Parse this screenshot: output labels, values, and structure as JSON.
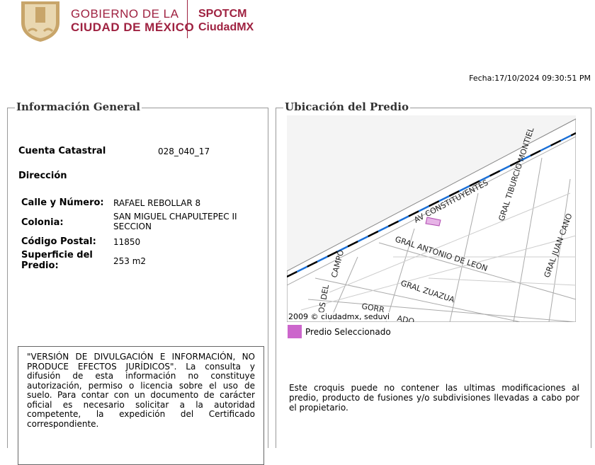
{
  "header": {
    "logo_text": "GOBIERNO DE LA CIUDAD DE MÉXICO",
    "gob_line1": "GOBIERNO DE LA",
    "gob_line2": "CIUDAD DE MÉXICO",
    "brand_line1": "SPOTCM",
    "brand_line2": "CiudadMX",
    "fecha": "Fecha:17/10/2024 09:30:51 PM"
  },
  "general": {
    "title": "Información General",
    "cuenta_label": "Cuenta Catastral",
    "cuenta_value": "028_040_17",
    "direccion_label": "Dirección",
    "calle_label": "Calle y Número:",
    "calle_value": "RAFAEL REBOLLAR 8",
    "colonia_label": "Colonia:",
    "colonia_value": "SAN MIGUEL CHAPULTEPEC II SECCION",
    "cp_label": "Código Postal:",
    "cp_value": "11850",
    "sup_label": "Superficie del Predio:",
    "sup_value": "253 m2",
    "disclaimer": "\"VERSIÓN DE DIVULGACIÓN E INFORMACIÓN, NO PRODUCE EFECTOS JURÍDICOS\". La consulta y difusión de esta información no constituye autorización, permiso o licencia sobre el uso de suelo. Para contar con un documento de carácter oficial es necesario solicitar a la autoridad competente, la expedición del Certificado correspondiente."
  },
  "ubicacion": {
    "title": "Ubicación del Predio",
    "streets": [
      "AV CONSTITUYENTES",
      "GRAL TIBURCIO MONTIEL",
      "GRAL JUAN CANO",
      "GRAL ANTONIO DE LEON",
      "GRAL ZUAZUA",
      "CAMPO",
      "OS DEL",
      "GORR",
      "ADO"
    ],
    "copyright": "2009 © ciudadmx, seduvi",
    "legend": "Predio Seleccionado",
    "legend_color": "#cc66cc",
    "note": "Este croquis puede no contener las ultimas modificaciones al predio, producto de fusiones y/o subdivisiones llevadas a cabo por el propietario."
  }
}
